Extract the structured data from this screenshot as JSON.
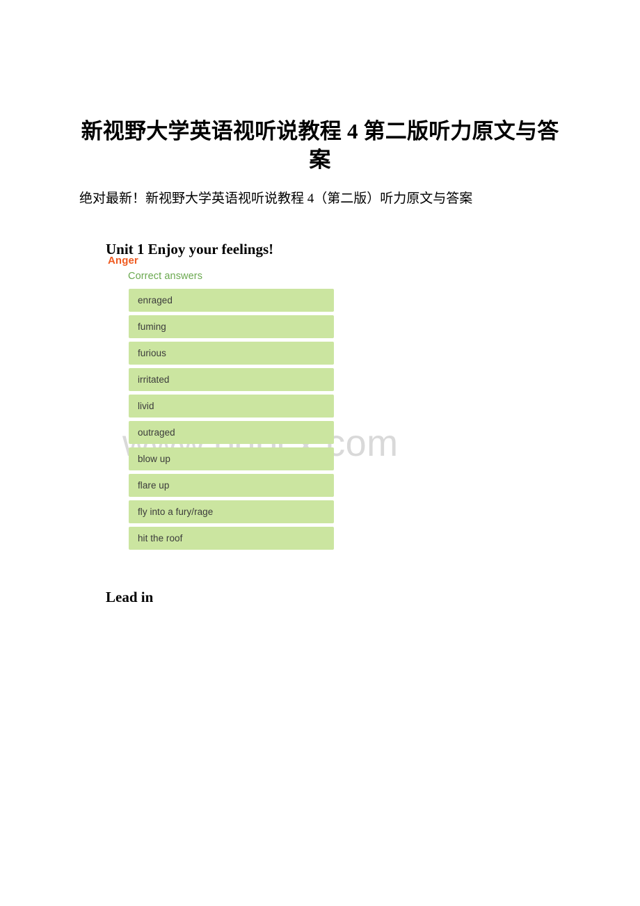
{
  "document": {
    "title": "新视野大学英语视听说教程 4 第二版听力原文与答案",
    "intro_paragraph": "绝对最新！新视野大学英语视听说教程 4（第二版）听力原文与答案",
    "unit_heading": "Unit 1 Enjoy your feelings!",
    "lead_in_heading": "Lead in"
  },
  "watermark": {
    "text": "www.bdocx.com",
    "color": "#d9d9d9"
  },
  "answer_card": {
    "title": "Anger",
    "title_color": "#ef5b21",
    "subtitle": "Correct answers",
    "subtitle_color": "#6aa84f",
    "item_background": "#cbe5a0",
    "items": [
      {
        "label": "enraged"
      },
      {
        "label": "fuming"
      },
      {
        "label": "furious"
      },
      {
        "label": "irritated"
      },
      {
        "label": "livid"
      },
      {
        "label": "outraged"
      },
      {
        "label": "blow up"
      },
      {
        "label": "flare up"
      },
      {
        "label": "fly into a fury/rage"
      },
      {
        "label": "hit the roof"
      }
    ]
  }
}
